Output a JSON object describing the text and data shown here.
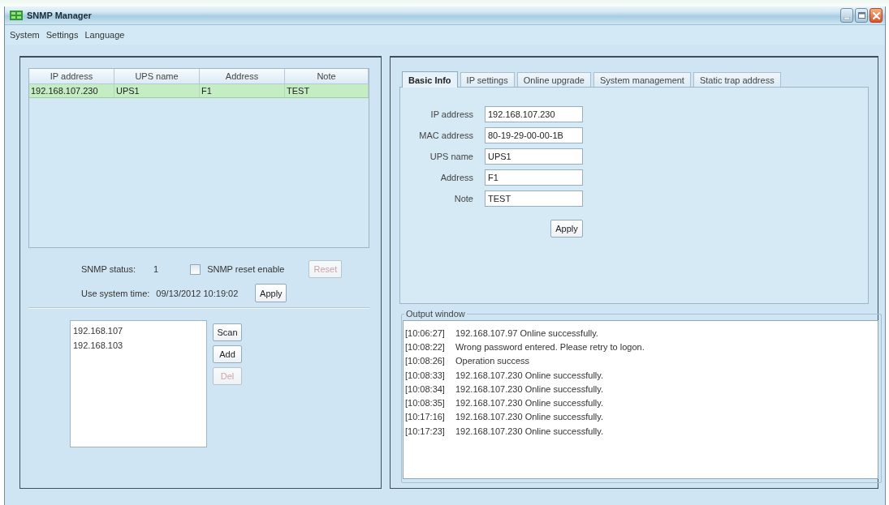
{
  "window": {
    "title": "SNMP Manager"
  },
  "menu": [
    {
      "label": "System"
    },
    {
      "label": "Settings"
    },
    {
      "label": "Language"
    }
  ],
  "device_table": {
    "columns": [
      "IP address",
      "UPS name",
      "Address",
      "Note"
    ],
    "rows": [
      {
        "cells": [
          "192.168.107.230",
          "UPS1",
          "F1",
          "TEST"
        ],
        "selected": true
      }
    ]
  },
  "snmp_status": {
    "label": "SNMP status:",
    "value": "1"
  },
  "snmp_reset": {
    "label": "SNMP reset enable",
    "checked": false
  },
  "reset_button": {
    "label": "Reset",
    "disabled": true
  },
  "system_time": {
    "label": "Use system time:",
    "value": "09/13/2012 10:19:02",
    "button": "Apply"
  },
  "scan": {
    "items": [
      "192.168.107",
      "192.168.103"
    ],
    "buttons": [
      {
        "label": "Scan",
        "disabled": false
      },
      {
        "label": "Add",
        "disabled": false
      },
      {
        "label": "Del",
        "disabled": true
      }
    ]
  },
  "tabs": [
    {
      "label": "Basic Info",
      "selected": true
    },
    {
      "label": "IP settings",
      "selected": false
    },
    {
      "label": "Online upgrade",
      "selected": false
    },
    {
      "label": "System management",
      "selected": false
    },
    {
      "label": "Static trap address",
      "selected": false
    }
  ],
  "basic_info": {
    "fields": [
      {
        "label": "IP address",
        "value": "192.168.107.230"
      },
      {
        "label": "MAC address",
        "value": "80-19-29-00-00-1B"
      },
      {
        "label": "UPS name",
        "value": "UPS1"
      },
      {
        "label": "Address",
        "value": "F1"
      },
      {
        "label": "Note",
        "value": "TEST"
      }
    ],
    "apply_button": "Apply"
  },
  "output_window": {
    "title": "Output window",
    "lines": [
      {
        "time": "[10:06:27]",
        "message": "192.168.107.97 Online successfully."
      },
      {
        "time": "[10:08:22]",
        "message": "Wrong password entered. Please retry to logon."
      },
      {
        "time": "[10:08:26]",
        "message": "Operation success"
      },
      {
        "time": "[10:08:33]",
        "message": "192.168.107.230 Online successfully."
      },
      {
        "time": "[10:08:34]",
        "message": "192.168.107.230 Online successfully."
      },
      {
        "time": "[10:08:35]",
        "message": "192.168.107.230 Online successfully."
      },
      {
        "time": "[10:17:16]",
        "message": "192.168.107.230 Online successfully."
      },
      {
        "time": "[10:17:23]",
        "message": "192.168.107.230 Online successfully."
      }
    ]
  }
}
